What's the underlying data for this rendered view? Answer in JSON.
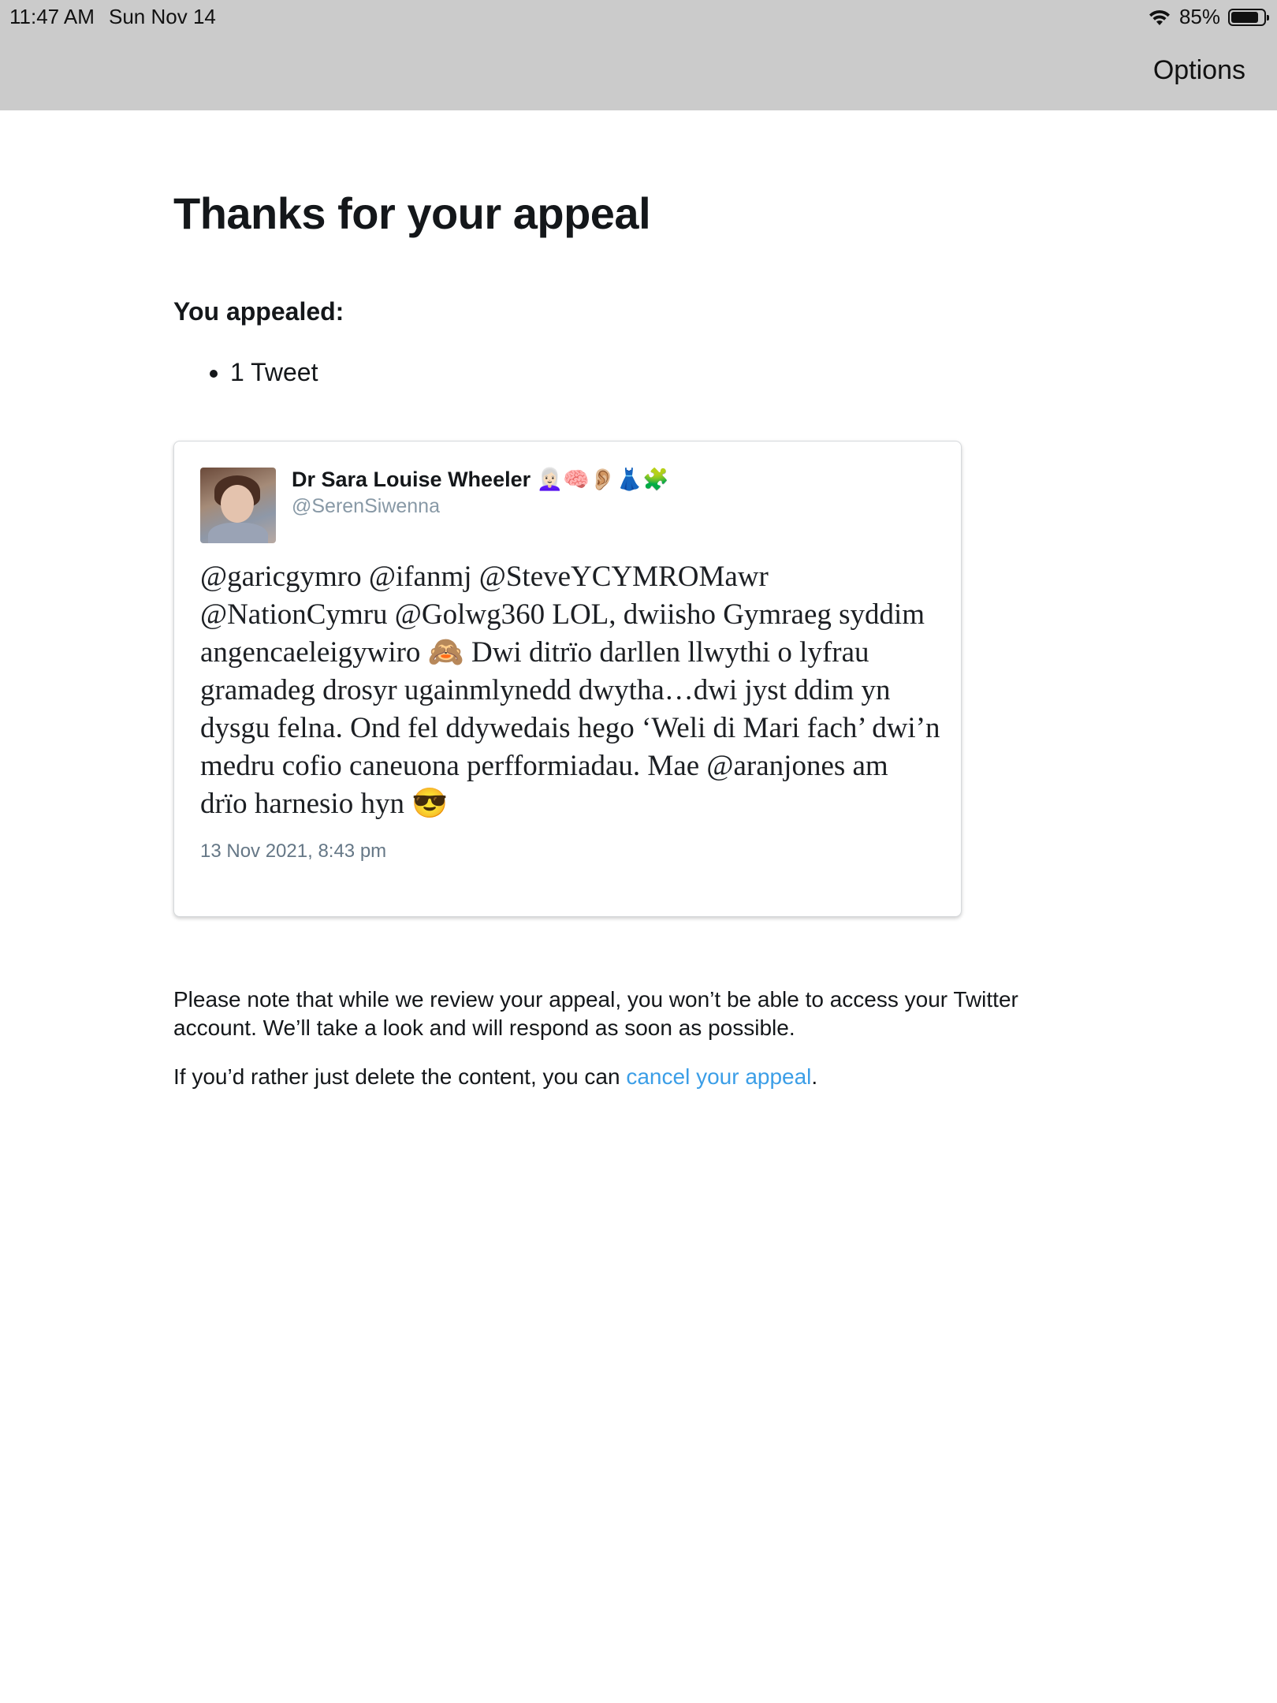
{
  "status_bar": {
    "time": "11:47 AM",
    "date": "Sun Nov 14",
    "battery": "85%",
    "battery_level": 0.85
  },
  "nav": {
    "options_label": "Options"
  },
  "page": {
    "title": "Thanks for your appeal",
    "appealed_label": "You appealed:",
    "appealed_items": [
      "1 Tweet"
    ]
  },
  "tweet": {
    "author": "Dr Sara Louise Wheeler 👩🏻‍🦳🧠👂🏼👗🧩",
    "handle": "@SerenSiwenna",
    "text": "@garicgymro @ifanmj @SteveYCYMROMawr @NationCymru @Golwg360 LOL, dwiisho Gymraeg syddim angencaeleigywiro 🙈 Dwi ditrïo darllen llwythi o lyfrau gramadeg drosyr ugainmlynedd dwytha…dwi jyst ddim yn dysgu felna. Ond fel ddywedais hego ‘Weli di Mari fach’ dwi’n medru cofio caneuona perfformiadau. Mae @aranjones am drïo harnesio hyn 😎",
    "timestamp": "13 Nov 2021, 8:43 pm"
  },
  "footer": {
    "note": "Please note that while we review your appeal, you won’t be able to access your Twitter account. We’ll take a look and will respond as soon as possible.",
    "cancel_prefix": "If you’d rather just delete the content, you can ",
    "cancel_link": "cancel your appeal",
    "cancel_suffix": "."
  },
  "colors": {
    "topbar": "#cbcbcb",
    "link": "#3b9ee7",
    "handle": "#8899a6"
  }
}
